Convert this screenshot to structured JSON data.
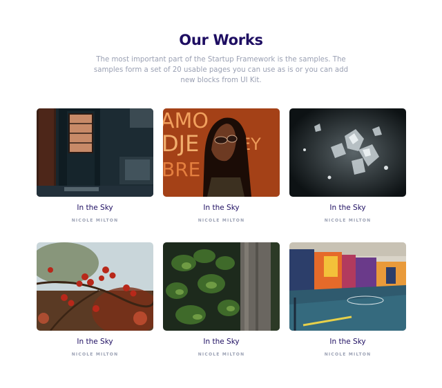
{
  "section": {
    "title": "Our Works",
    "description": "The most important part of the Startup Framework is the samples. The samples form a set of 20 usable pages you can use as is or you can add new blocks from UI Kit."
  },
  "works": [
    {
      "title": "In the Sky",
      "author": "NICOLE MILTON",
      "image": "dark-doorway-photo"
    },
    {
      "title": "In the Sky",
      "author": "NICOLE MILTON",
      "image": "neon-portrait-photo"
    },
    {
      "title": "In the Sky",
      "author": "NICOLE MILTON",
      "image": "crystal-cluster-photo"
    },
    {
      "title": "In the Sky",
      "author": "NICOLE MILTON",
      "image": "red-berries-photo"
    },
    {
      "title": "In the Sky",
      "author": "NICOLE MILTON",
      "image": "ivy-tree-photo"
    },
    {
      "title": "In the Sky",
      "author": "NICOLE MILTON",
      "image": "basketball-court-photo"
    }
  ]
}
